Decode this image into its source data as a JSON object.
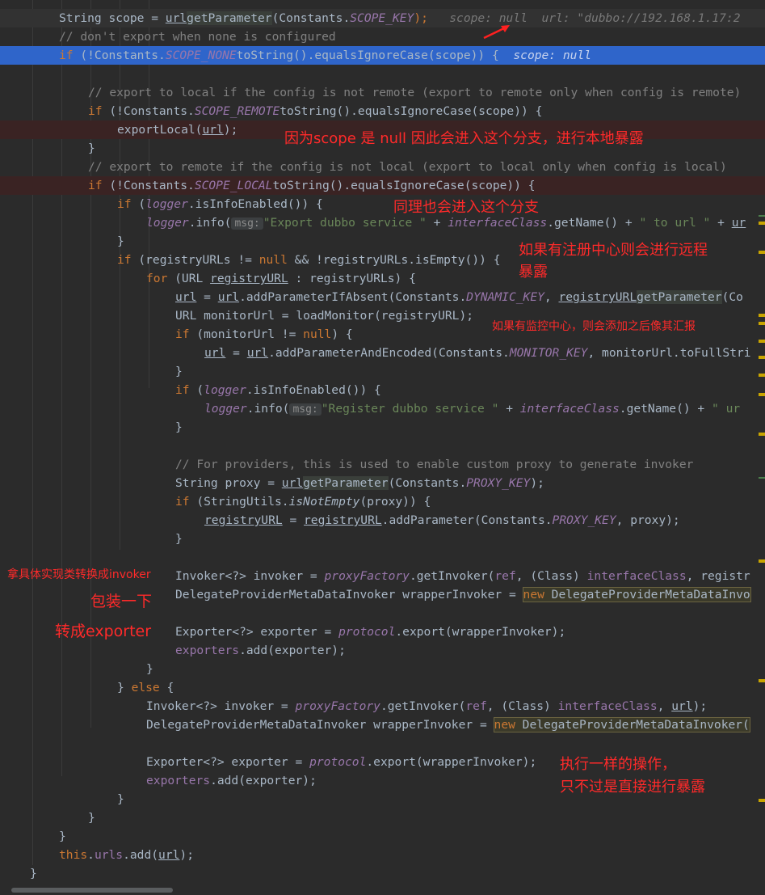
{
  "code": {
    "l1": {
      "a": "String scope = ",
      "b": "url",
      ".": ".",
      "c": "getParameter",
      "d": "(Constants.",
      "e": "SCOPE_KEY",
      "f": ");"
    },
    "l1_dbg": "scope: null  url: \"dubbo://192.168.1.17:2",
    "l2": "// don't export when none is configured",
    "l3": {
      "a": "if",
      "b": " (!Constants.",
      "c": "SCOPE_NONE",
      ".": ".",
      "d": "toString",
      "e": "()",
      "f": ".equalsIgnoreCase(scope)) {"
    },
    "l3_dbg": "scope: null",
    "l5": "// export to local if the config is not remote (export to remote only when config is remote)",
    "l6": {
      "a": "if",
      "b": " (!Constants.",
      "c": "SCOPE_REMOTE",
      ".": ".",
      "d": "toString",
      "e": "()",
      "f": ".equalsIgnoreCase(scope)) {"
    },
    "l7": {
      "a": "exportLocal(",
      "b": "url",
      "c": ");"
    },
    "l8": "}",
    "l9": "// export to remote if the config is not local (export to local only when config is local)",
    "l10": {
      "a": "if",
      "b": " (!Constants.",
      "c": "SCOPE_LOCAL",
      ".": ".",
      "d": "toString",
      "e": "()",
      "f": ".equalsIgnoreCase(scope)) {"
    },
    "l11": {
      "a": "if",
      "b": " (",
      "c": "logger",
      "d": ".isInfoEnabled()) {"
    },
    "l12": {
      "a": "logger",
      "b": ".info(",
      "hint": "msg:",
      "s": "\"Export dubbo service \"",
      "c": " + ",
      "d": "interfaceClass",
      "e": ".getName() + ",
      "s2": "\" to url \"",
      "f": " + ",
      "g": "ur"
    },
    "l13": "}",
    "l14": {
      "a": "if",
      "b": " (registryURLs != ",
      "c": "null",
      "d": " && !registryURLs.isEmpty()) {"
    },
    "l15": {
      "a": "for",
      "b": " (URL ",
      "c": "registryURL",
      "d": " : registryURLs) {"
    },
    "l16": {
      "a": "url",
      "b": " = ",
      "c": "url",
      "d": ".addParameterIfAbsent(Constants.",
      "e": "DYNAMIC_KEY",
      "f": ", ",
      "g": "registryURL",
      ".": ".",
      "h": "getParameter",
      "i": "(Co"
    },
    "l17": "URL monitorUrl = loadMonitor(registryURL);",
    "l18": {
      "a": "if",
      "b": " (monitorUrl != ",
      "c": "null",
      "d": ") {"
    },
    "l19": {
      "a": "url",
      "b": " = ",
      "c": "url",
      "d": ".addParameterAndEncoded(Constants.",
      "e": "MONITOR_KEY",
      "f": ", monitorUrl.toFullStri"
    },
    "l20": "}",
    "l21": {
      "a": "if",
      "b": " (",
      "c": "logger",
      "d": ".isInfoEnabled()) {"
    },
    "l22": {
      "a": "logger",
      "b": ".info(",
      "hint": "msg:",
      "s": "\"Register dubbo service \"",
      "c": " + ",
      "d": "interfaceClass",
      "e": ".getName() + ",
      "s2": "\" ur"
    },
    "l23": "}",
    "l25": "// For providers, this is used to enable custom proxy to generate invoker",
    "l26": {
      "a": "String proxy = ",
      "b": "url",
      ".": ".",
      "c": "getParameter",
      "d": "(Constants.",
      "e": "PROXY_KEY",
      "f": ");"
    },
    "l27": {
      "a": "if",
      "b": " (StringUtils.",
      "c": "isNotEmpty",
      "d": "(proxy)) {"
    },
    "l28": {
      "a": "registryURL",
      "b": " = ",
      "c": "registryURL",
      "d": ".addParameter(Constants.",
      "e": "PROXY_KEY",
      "f": ", proxy);"
    },
    "l29": "}",
    "l31": {
      "a": "Invoker<?> invoker = ",
      "b": "proxyFactory",
      "c": ".getInvoker(",
      "d": "ref",
      "e": ", (Class) ",
      "f": "interfaceClass",
      "g": ", registr"
    },
    "l32": {
      "a": "DelegateProviderMetaDataInvoker wrapperInvoker = ",
      "b": "new",
      "c": " DelegateProviderMetaDataInvo"
    },
    "l34": {
      "a": "Exporter<?> exporter = ",
      "b": "protocol",
      "c": ".export(wrapperInvoker);"
    },
    "l35": {
      "a": "exporters",
      "b": ".add(exporter);"
    },
    "l36": "}",
    "l37": {
      "a": "} ",
      "b": "else",
      "c": " {"
    },
    "l38": {
      "a": "Invoker<?> invoker = ",
      "b": "proxyFactory",
      "c": ".getInvoker(",
      "d": "ref",
      "e": ", (Class) ",
      "f": "interfaceClass",
      "g": ", ",
      "h": "url",
      "i": ");"
    },
    "l39": {
      "a": "DelegateProviderMetaDataInvoker wrapperInvoker = ",
      "b": "new",
      "c": " DelegateProviderMetaDataInvoker("
    },
    "l41": {
      "a": "Exporter<?> exporter = ",
      "b": "protocol",
      "c": ".export(wrapperInvoker);"
    },
    "l42": {
      "a": "exporters",
      "b": ".add(exporter);"
    },
    "l43": "}",
    "l44": "}",
    "l45": "}",
    "l46": {
      "a": "this",
      "b": ".",
      "c": "urls",
      "d": ".add(",
      "e": "url",
      "f": ");"
    },
    "l47": "}"
  },
  "notes": {
    "n1": "因为scope 是 null 因此会进入这个分支，进行本地暴露",
    "n2": "同理也会进入这个分支",
    "n3a": "如果有注册中心则会进行远程",
    "n3b": "暴露",
    "n4": "如果有监控中心，则会添加之后像其汇报",
    "n5": "拿具体实现类转换成invoker",
    "n6": "包装一下",
    "n7": "转成exporter",
    "n8a": "执行一样的操作，",
    "n8b": "只不过是直接进行暴露"
  },
  "icons": {
    "arrow": "red-arrow-icon"
  }
}
